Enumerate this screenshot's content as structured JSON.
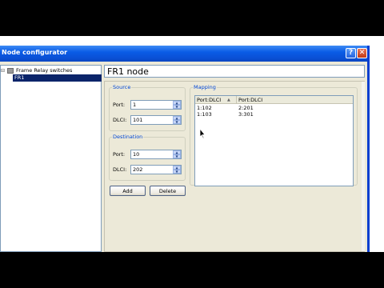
{
  "window": {
    "title": "Node configurator",
    "help_glyph": "?",
    "close_glyph": "✕"
  },
  "tree": {
    "expander": "⊟",
    "root_label": "Frame Relay switches",
    "selected_label": "FR1"
  },
  "detail": {
    "node_title": "FR1 node",
    "source": {
      "legend": "Source",
      "port_label": "Port:",
      "port_value": "1",
      "dlci_label": "DLCI:",
      "dlci_value": "101"
    },
    "destination": {
      "legend": "Destination",
      "port_label": "Port:",
      "port_value": "10",
      "dlci_label": "DLCI:",
      "dlci_value": "202"
    },
    "add_label": "Add",
    "delete_label": "Delete",
    "mapping": {
      "legend": "Mapping",
      "columns": [
        "Port:DLCI",
        "Port:DLCI"
      ],
      "sort_glyph": "▲",
      "rows": [
        [
          "1:102",
          "2:201"
        ],
        [
          "1:103",
          "3:301"
        ]
      ]
    }
  },
  "colors": {
    "titlebar": "#0a5ce6",
    "selection": "#0a246a",
    "group_legend": "#0046d5",
    "face": "#ece9d8"
  }
}
